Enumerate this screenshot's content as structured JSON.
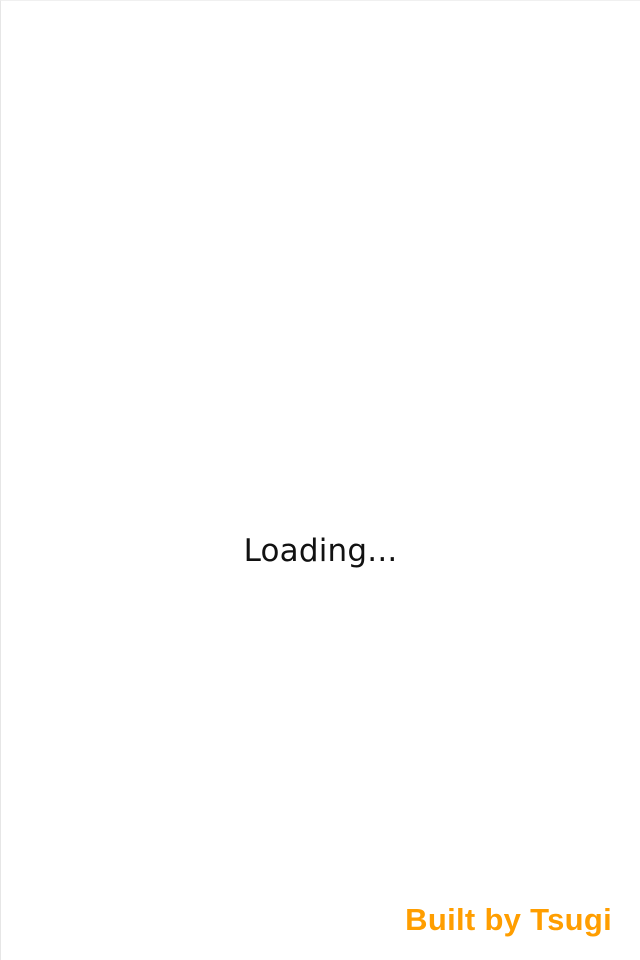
{
  "status": {
    "loading_text": "Loading..."
  },
  "footer": {
    "credit_text": "Built by Tsugi"
  },
  "colors": {
    "background": "#ffffff",
    "text": "#111111",
    "accent": "#ff9e00"
  }
}
